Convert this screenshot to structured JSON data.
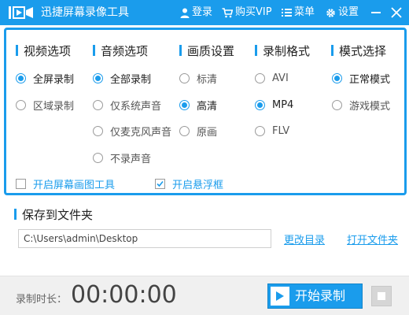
{
  "app": {
    "title": "迅捷屏幕录像工具"
  },
  "titlebar": {
    "login": "登录",
    "vip": "购买VIP",
    "menu": "菜单",
    "settings": "设置"
  },
  "options": {
    "video": {
      "title": "视频选项",
      "items": [
        {
          "label": "全屏录制",
          "checked": true
        },
        {
          "label": "区域录制",
          "checked": false
        }
      ]
    },
    "audio": {
      "title": "音频选项",
      "items": [
        {
          "label": "全部录制",
          "checked": true
        },
        {
          "label": "仅系统声音",
          "checked": false
        },
        {
          "label": "仅麦克风声音",
          "checked": false
        },
        {
          "label": "不录声音",
          "checked": false
        }
      ]
    },
    "quality": {
      "title": "画质设置",
      "items": [
        {
          "label": "标清",
          "checked": false
        },
        {
          "label": "高清",
          "checked": true
        },
        {
          "label": "原画",
          "checked": false
        }
      ]
    },
    "format": {
      "title": "录制格式",
      "items": [
        {
          "label": "AVI",
          "checked": false
        },
        {
          "label": "MP4",
          "checked": true
        },
        {
          "label": "FLV",
          "checked": false
        }
      ]
    },
    "mode": {
      "title": "模式选择",
      "items": [
        {
          "label": "正常模式",
          "checked": true
        },
        {
          "label": "游戏模式",
          "checked": false
        }
      ]
    },
    "drawing_tool": {
      "label": "开启屏幕画图工具",
      "checked": false
    },
    "floating_window": {
      "label": "开启悬浮框",
      "checked": true
    }
  },
  "save": {
    "title": "保存到文件夹",
    "path": "C:\\Users\\admin\\Desktop",
    "change_dir": "更改目录",
    "open_folder": "打开文件夹"
  },
  "bottom": {
    "duration_label": "录制时长：",
    "timer": "00:00:00",
    "start_label": "开始录制"
  },
  "colors": {
    "accent": "#1a9cec",
    "bottom_bar": "#f0f0f0"
  }
}
